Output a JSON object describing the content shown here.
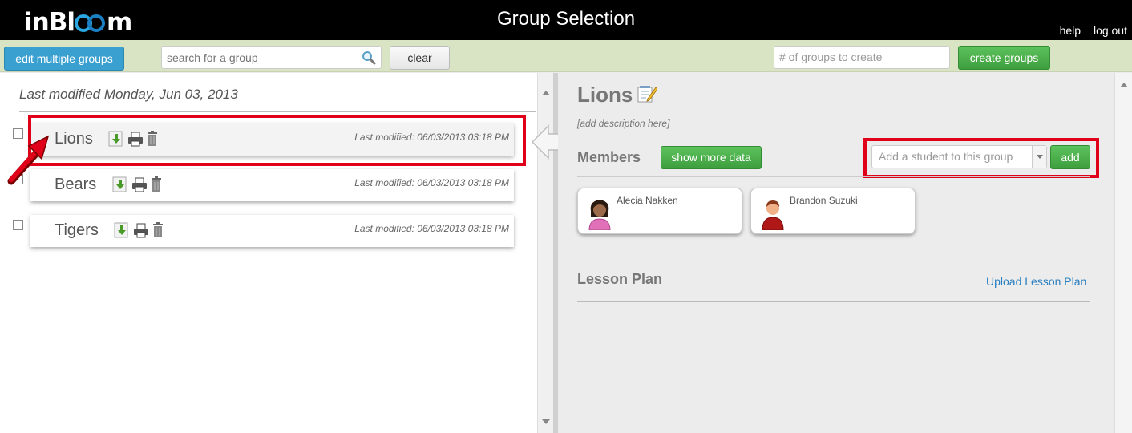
{
  "header": {
    "logo_text": "inBl",
    "logo_suffix": "m",
    "title": "Group Selection",
    "links": {
      "help": "help",
      "logout": "log out"
    }
  },
  "toolbar": {
    "edit_multiple": "edit multiple groups",
    "search_placeholder": "search for a group",
    "clear": "clear",
    "groups_count_placeholder": "# of groups to create",
    "create_groups": "create groups"
  },
  "left": {
    "last_modified_heading": "Last modified Monday, Jun 03, 2013",
    "groups": [
      {
        "name": "Lions",
        "modified": "Last modified: 06/03/2013 03:18 PM",
        "selected": true
      },
      {
        "name": "Bears",
        "modified": "Last modified: 06/03/2013 03:18 PM",
        "selected": false
      },
      {
        "name": "Tigers",
        "modified": "Last modified: 06/03/2013 03:18 PM",
        "selected": false
      }
    ]
  },
  "detail": {
    "title": "Lions",
    "description": "[add description here]",
    "members_label": "Members",
    "show_more": "show more data",
    "add_student_placeholder": "Add a student to this group",
    "add": "add",
    "members": [
      {
        "name": "Alecia Nakken",
        "avatar": "female-student-icon"
      },
      {
        "name": "Brandon Suzuki",
        "avatar": "male-student-icon"
      }
    ],
    "lesson_plan_label": "Lesson Plan",
    "upload_lesson_plan": "Upload Lesson Plan"
  },
  "colors": {
    "header_bg": "#000000",
    "toolbar_bg": "#d9e4c4",
    "accent_blue": "#3aa0d0",
    "accent_green": "#4cae4c",
    "highlight_red": "#e0001a"
  }
}
